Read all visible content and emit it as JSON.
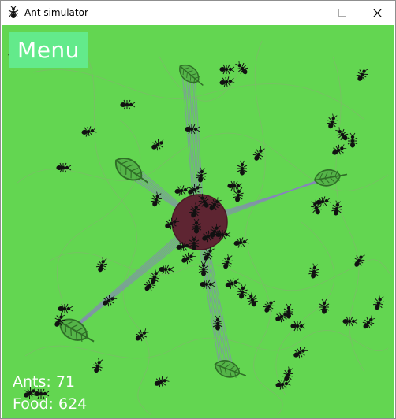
{
  "window": {
    "title": "Ant simulator",
    "controls": [
      "minimize",
      "maximize",
      "close"
    ]
  },
  "menu": {
    "label": "Menu"
  },
  "stats": {
    "ants_label": "Ants: 71",
    "food_label": "Food: 624",
    "ants": 71,
    "food": 624
  },
  "colors": {
    "ground": "#63d651",
    "nest": "#5e2532",
    "menu_button": "#63ea8b",
    "trail": "#8a7fc4",
    "ant": "#111111",
    "leaf": "#54b448"
  },
  "icons": {
    "app": "ant-icon",
    "minimize": "minimize-icon",
    "maximize": "maximize-icon",
    "close": "close-icon"
  }
}
